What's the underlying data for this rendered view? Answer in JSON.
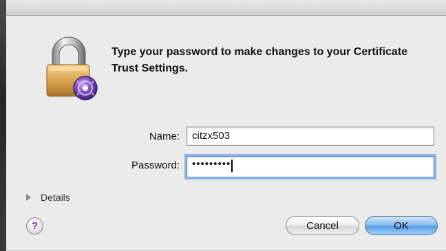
{
  "dialog": {
    "message": "Type your password to make changes to your Certificate Trust Settings.",
    "icon": "lock-icon"
  },
  "form": {
    "name_label": "Name:",
    "name_value": "citzx503",
    "password_label": "Password:",
    "password_masked": "•••••••••"
  },
  "details": {
    "label": "Details"
  },
  "help": {
    "glyph": "?"
  },
  "buttons": {
    "cancel_label": "Cancel",
    "ok_label": "OK"
  },
  "colors": {
    "dialog_bg": "#ebebeb",
    "focus_ring": "#8cb4e8",
    "ok_button": "#5a9ee6",
    "lock_gold": "#d9a452",
    "badge_purple": "#6a3fa0"
  }
}
